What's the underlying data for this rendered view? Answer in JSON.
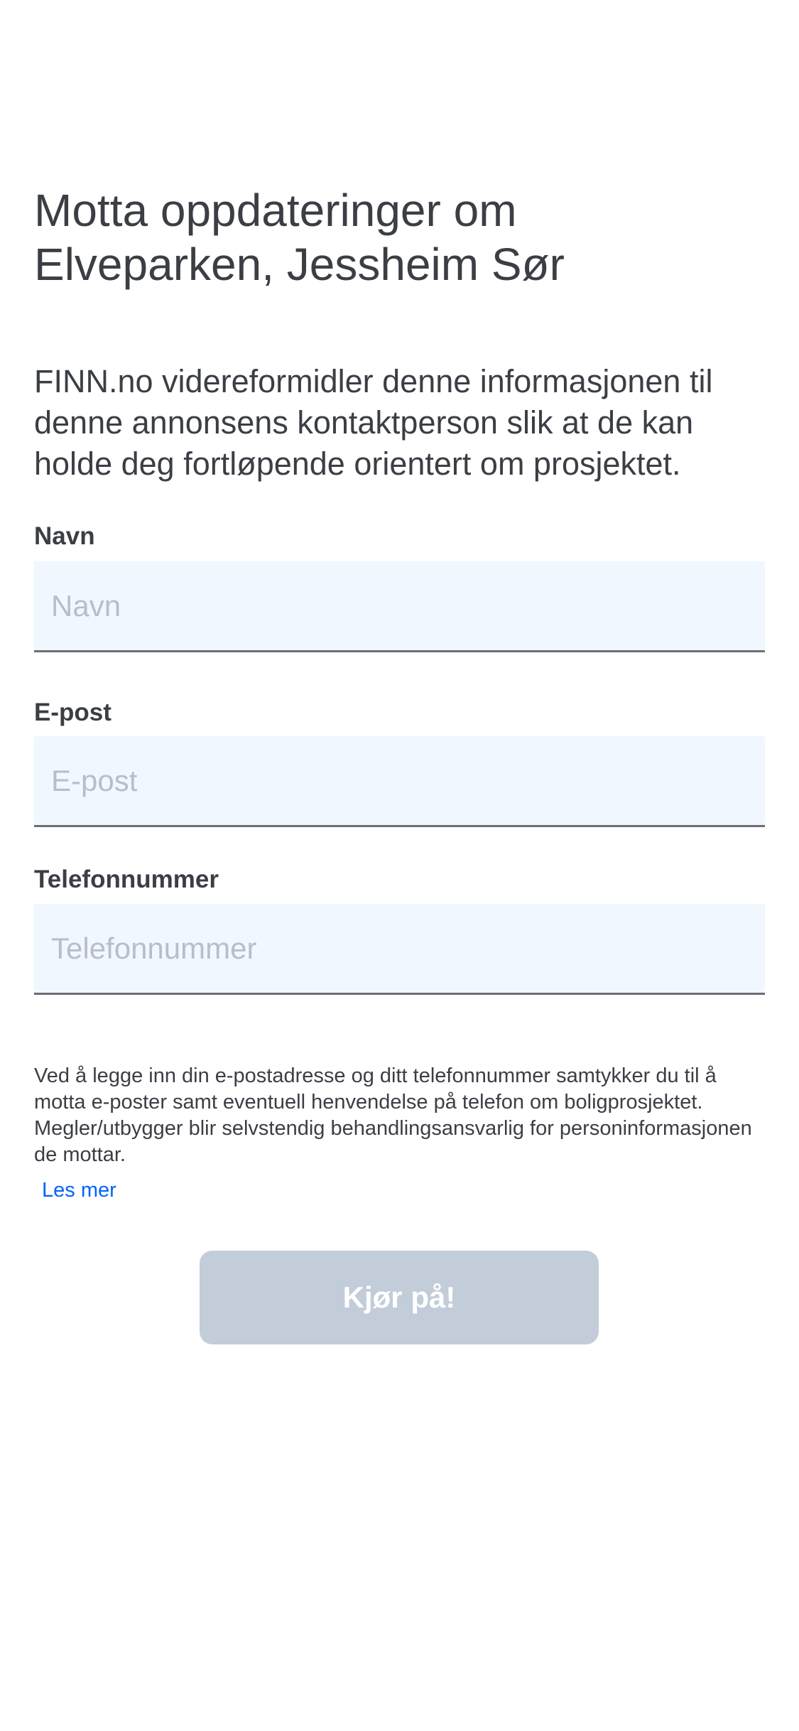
{
  "page": {
    "title": "Motta oppdateringer om Elveparken, Jessheim Sør",
    "description": "FINN.no videreformidler denne informasjonen til denne annonsens kontaktperson slik at de kan holde deg fortløpende orientert om prosjektet."
  },
  "form": {
    "fields": [
      {
        "label": "Navn",
        "placeholder": "Navn",
        "value": ""
      },
      {
        "label": "E-post",
        "placeholder": "E-post",
        "value": ""
      },
      {
        "label": "Telefonnummer",
        "placeholder": "Telefonnummer",
        "value": ""
      }
    ],
    "consent_text": "Ved å legge inn din e-postadresse og ditt telefonnummer samtykker du til å motta e-poster samt eventuell henvendelse på telefon om boligprosjektet. Megler/utbygger blir selvstendig behandlingsansvarlig for personinformasjonen de mottar.",
    "read_more_label": "Les mer",
    "submit_label": "Kjør på!"
  },
  "colors": {
    "text": "#3b3e45",
    "input_background": "#f1f7ff",
    "link": "#0063fb",
    "button_disabled": "#c3ccd9"
  }
}
